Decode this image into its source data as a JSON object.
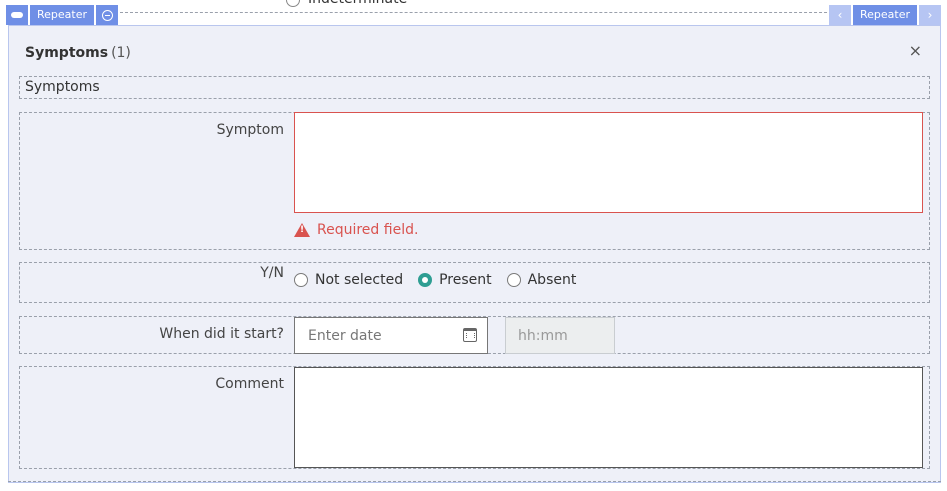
{
  "top": {
    "partial_option_label": "Indeterminate"
  },
  "repeater": {
    "left_label": "Repeater",
    "right_label": "Repeater",
    "prev_symbol": "‹",
    "next_symbol": "›"
  },
  "panel": {
    "title": "Symptoms",
    "count": "(1)",
    "close_symbol": "×",
    "section_title": "Symptoms"
  },
  "fields": {
    "symptom": {
      "label": "Symptom",
      "value": "",
      "error": "Required field."
    },
    "yn": {
      "label": "Y/N",
      "options": [
        "Not selected",
        "Present",
        "Absent"
      ],
      "selected": "Present"
    },
    "start": {
      "label": "When did it start?",
      "date_placeholder": "Enter date",
      "time_placeholder": "hh:mm"
    },
    "comment": {
      "label": "Comment",
      "value": ""
    }
  },
  "colors": {
    "toolbar": "#6f8fe6",
    "panel_bg": "#eef0f8",
    "error": "#d9534f",
    "radio_selected": "#2f9e93"
  },
  "icons": [
    "pill-icon",
    "collapse-icon",
    "close-icon",
    "warning-icon",
    "calendar-icon",
    "chevron-left-icon",
    "chevron-right-icon"
  ]
}
